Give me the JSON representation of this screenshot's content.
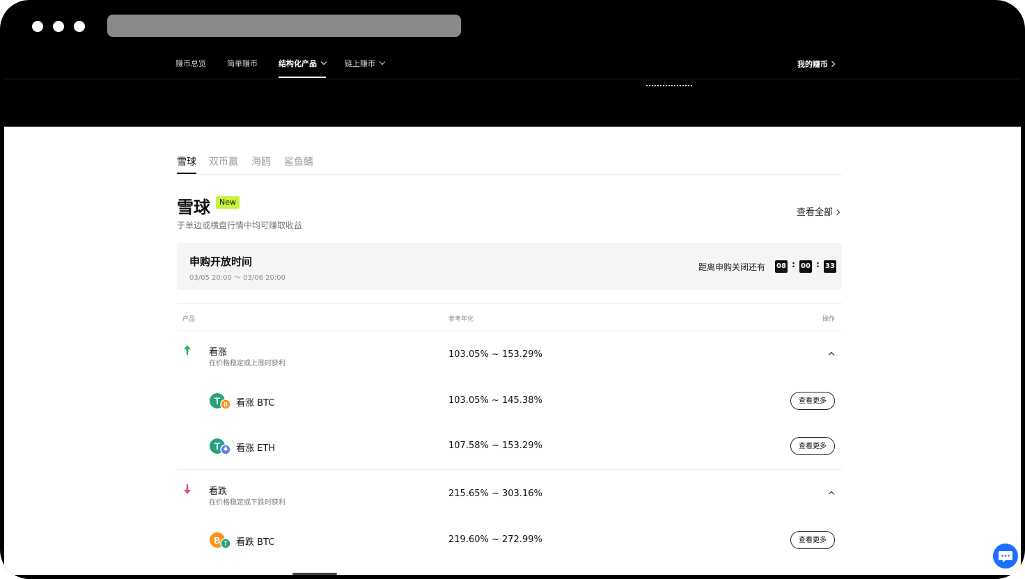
{
  "topnav": {
    "items": [
      "赚币总览",
      "简单赚币",
      "结构化产品",
      "链上赚币"
    ],
    "right_label": "我的赚币"
  },
  "tabs": [
    "雪球",
    "双币赢",
    "海鸥",
    "鲨鱼鳍"
  ],
  "section": {
    "title": "雪球",
    "badge": "New",
    "subtitle": "于单边或横盘行情中均可赚取收益",
    "view_all": "查看全部"
  },
  "subscription": {
    "title": "申购开放时间",
    "period": "03/05 20:00 ～ 03/06 20:00",
    "countdown_label": "距离申购关闭还有",
    "hours": "08",
    "minutes": "00",
    "seconds": "33",
    "separator": ":"
  },
  "table": {
    "headers": [
      "产品",
      "参考年化",
      "操作"
    ],
    "groups": [
      {
        "direction": "up",
        "icon": "arrow-up-icon",
        "name": "看涨",
        "desc": "在价格稳定或上涨时获利",
        "rate": "103.05% ~ 153.29%",
        "items": [
          {
            "name": "看涨 BTC",
            "rate": "103.05% ~ 145.38%",
            "action": "查看更多",
            "coin": "usdt-btc-icon"
          },
          {
            "name": "看涨 ETH",
            "rate": "107.58% ~ 153.29%",
            "action": "查看更多",
            "coin": "usdt-eth-icon"
          }
        ]
      },
      {
        "direction": "down",
        "icon": "arrow-down-icon",
        "name": "看跌",
        "desc": "在价格稳定或下跌时获利",
        "rate": "215.65% ~ 303.16%",
        "items": [
          {
            "name": "看跌 BTC",
            "rate": "219.60% ~ 272.99%",
            "action": "查看更多",
            "coin": "btc-usdt-icon"
          }
        ]
      }
    ]
  },
  "colors": {
    "up": "#22b65c",
    "down": "#e5486e",
    "badge": "#c6f43c",
    "usdt": "#26a17b",
    "btc": "#f7931a",
    "eth": "#627eea",
    "chat": "#1e6fff"
  }
}
